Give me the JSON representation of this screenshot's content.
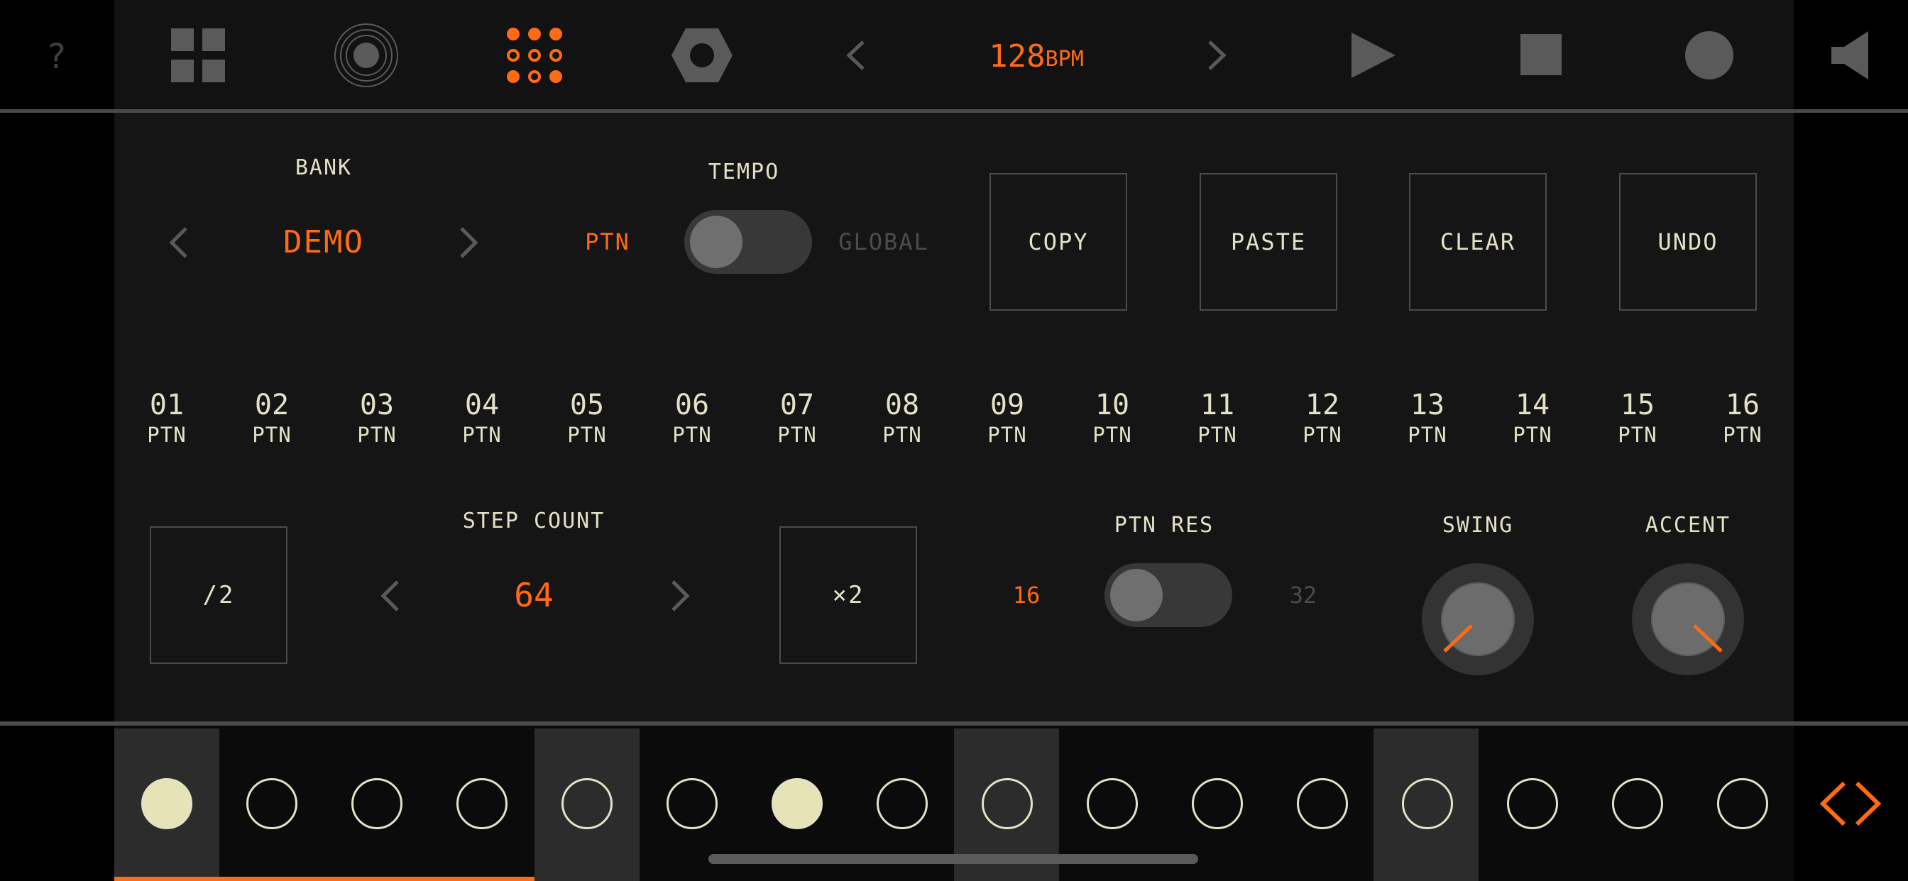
{
  "topbar": {
    "help_label": "?",
    "bpm_value": "128",
    "bpm_unit": "BPM"
  },
  "bank": {
    "label": "BANK",
    "value": "DEMO"
  },
  "tempo": {
    "label": "TEMPO",
    "left_option": "PTN",
    "right_option": "GLOBAL"
  },
  "actions": {
    "copy": "COPY",
    "paste": "PASTE",
    "clear": "CLEAR",
    "undo": "UNDO"
  },
  "patterns": [
    {
      "num": "01",
      "sub": "PTN",
      "active": true
    },
    {
      "num": "02",
      "sub": "PTN"
    },
    {
      "num": "03",
      "sub": "PTN"
    },
    {
      "num": "04",
      "sub": "PTN"
    },
    {
      "num": "05",
      "sub": "PTN"
    },
    {
      "num": "06",
      "sub": "PTN"
    },
    {
      "num": "07",
      "sub": "PTN"
    },
    {
      "num": "08",
      "sub": "PTN"
    },
    {
      "num": "09",
      "sub": "PTN"
    },
    {
      "num": "10",
      "sub": "PTN"
    },
    {
      "num": "11",
      "sub": "PTN"
    },
    {
      "num": "12",
      "sub": "PTN"
    },
    {
      "num": "13",
      "sub": "PTN"
    },
    {
      "num": "14",
      "sub": "PTN"
    },
    {
      "num": "15",
      "sub": "PTN"
    },
    {
      "num": "16",
      "sub": "PTN"
    }
  ],
  "step_count": {
    "label": "STEP COUNT",
    "value": "64",
    "halve": "/2",
    "double": "×2"
  },
  "ptn_res": {
    "label": "PTN RES",
    "left_option": "16",
    "right_option": "32"
  },
  "knobs": {
    "swing": "SWING",
    "accent": "ACCENT"
  },
  "steps": [
    true,
    false,
    false,
    false,
    false,
    false,
    true,
    false,
    false,
    false,
    false,
    false,
    false,
    false,
    false,
    false
  ],
  "colors": {
    "accent": "#ff6a14",
    "text": "#e3e1c6",
    "step_filled": "#e6e4b6"
  }
}
